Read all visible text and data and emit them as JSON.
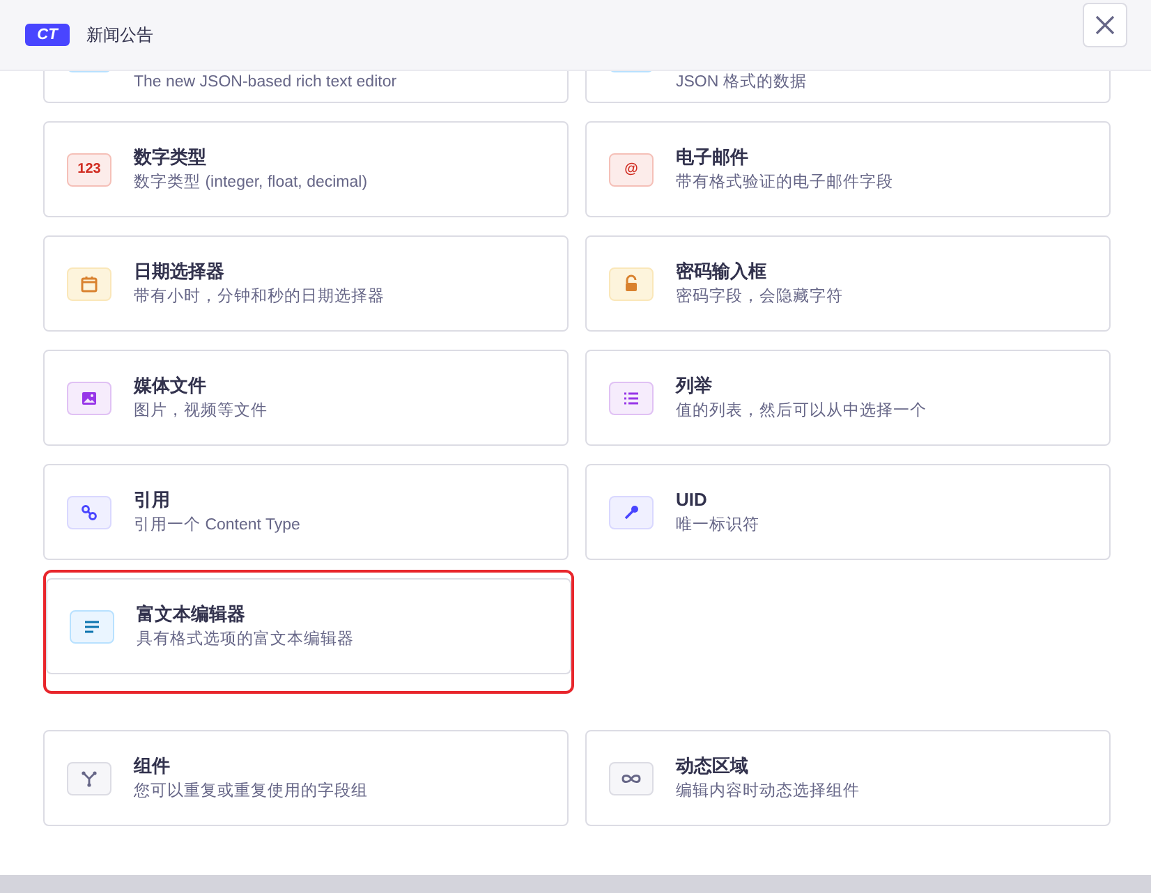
{
  "header": {
    "logo": "CT",
    "title": "新闻公告"
  },
  "field_groups": [
    {
      "fields": [
        {
          "kind": "blocks",
          "description": "The new JSON-based rich text editor",
          "highlighted": false
        },
        {
          "kind": "json",
          "description": "JSON 格式的数据",
          "highlighted": false
        },
        {
          "kind": "number",
          "title": "数字类型",
          "description": "数字类型 (integer, float, decimal)",
          "icon_text": "123",
          "highlighted": false
        },
        {
          "kind": "email",
          "title": "电子邮件",
          "description": "带有格式验证的电子邮件字段",
          "icon_text": "@",
          "highlighted": false
        },
        {
          "kind": "date",
          "title": "日期选择器",
          "description": "带有小时，分钟和秒的日期选择器",
          "highlighted": false
        },
        {
          "kind": "password",
          "title": "密码输入框",
          "description": "密码字段，会隐藏字符",
          "highlighted": false
        },
        {
          "kind": "media",
          "title": "媒体文件",
          "description": "图片，视频等文件",
          "highlighted": false
        },
        {
          "kind": "enumeration",
          "title": "列举",
          "description": "值的列表，然后可以从中选择一个",
          "highlighted": false
        },
        {
          "kind": "relation",
          "title": "引用",
          "description": "引用一个 Content Type",
          "highlighted": false
        },
        {
          "kind": "uid",
          "title": "UID",
          "description": "唯一标识符",
          "highlighted": false
        },
        {
          "kind": "richtext",
          "title": "富文本编辑器",
          "description": "具有格式选项的富文本编辑器",
          "highlighted": true
        }
      ]
    },
    {
      "fields": [
        {
          "kind": "component",
          "title": "组件",
          "description": "您可以重复或重复使用的字段组",
          "highlighted": false
        },
        {
          "kind": "dynamiczone",
          "title": "动态区域",
          "description": "编辑内容时动态选择组件",
          "highlighted": false
        }
      ]
    }
  ]
}
